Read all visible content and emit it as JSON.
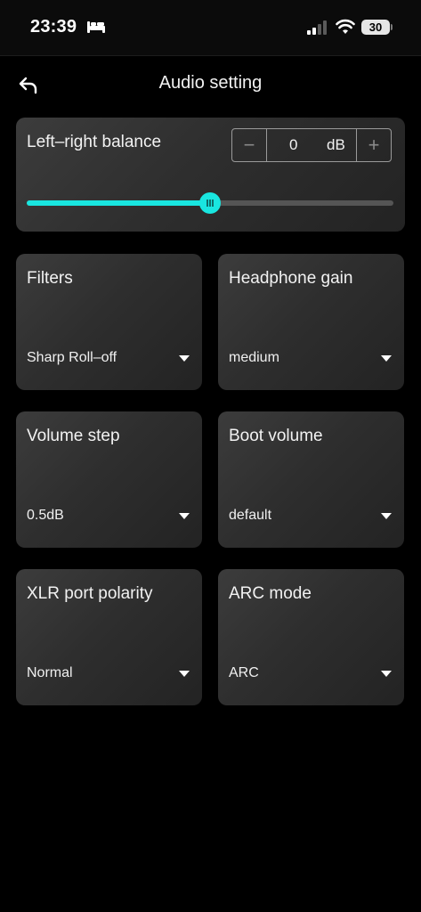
{
  "status_bar": {
    "time": "23:39",
    "battery": "30"
  },
  "icons": {
    "status": [
      "bed-icon",
      "signal-icon",
      "wifi-icon",
      "battery-icon"
    ],
    "back": "back-arrow-icon",
    "dropdown": "caret-down-icon"
  },
  "header": {
    "title": "Audio setting"
  },
  "balance": {
    "label": "Left–right balance",
    "value": "0",
    "unit": "dB",
    "minus": "−",
    "plus": "+",
    "slider_fraction": 0.5
  },
  "settings": [
    {
      "label": "Filters",
      "value": "Sharp Roll–off"
    },
    {
      "label": "Headphone gain",
      "value": "medium"
    },
    {
      "label": "Volume step",
      "value": "0.5dB"
    },
    {
      "label": "Boot volume",
      "value": "default"
    },
    {
      "label": "XLR port polarity",
      "value": "Normal"
    },
    {
      "label": "ARC mode",
      "value": "ARC"
    }
  ],
  "colors": {
    "accent": "#19e6e0",
    "background": "#000000",
    "card": "#333333"
  }
}
